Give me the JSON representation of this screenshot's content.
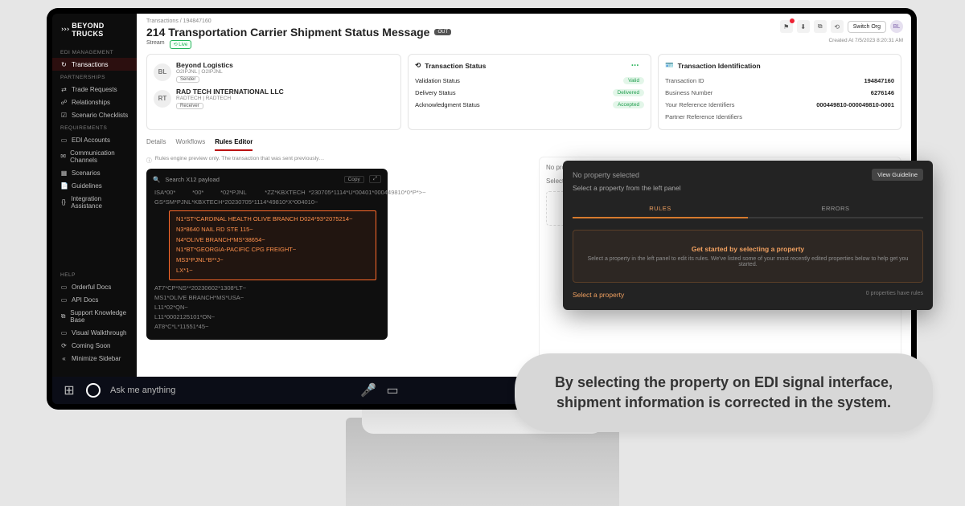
{
  "brand": {
    "name": "BEYOND TRUCKS"
  },
  "sidebar": {
    "section1_label": "EDI MANAGEMENT",
    "items1": [
      {
        "icon": "↻",
        "label": "Transactions",
        "active": true
      }
    ],
    "section2_label": "PARTNERSHIPS",
    "items2": [
      {
        "icon": "⇄",
        "label": "Trade Requests"
      },
      {
        "icon": "☍",
        "label": "Relationships"
      },
      {
        "icon": "☑",
        "label": "Scenario Checklists"
      }
    ],
    "section3_label": "REQUIREMENTS",
    "items3": [
      {
        "icon": "▭",
        "label": "EDI Accounts"
      },
      {
        "icon": "✉",
        "label": "Communication Channels"
      },
      {
        "icon": "▦",
        "label": "Scenarios"
      },
      {
        "icon": "📄",
        "label": "Guidelines"
      },
      {
        "icon": "{}",
        "label": "Integration Assistance"
      }
    ],
    "section4_label": "HELP",
    "items4": [
      {
        "icon": "▭",
        "label": "Orderful Docs"
      },
      {
        "icon": "▭",
        "label": "API Docs"
      },
      {
        "icon": "⧉",
        "label": "Support Knowledge Base"
      },
      {
        "icon": "▭",
        "label": "Visual Walkthrough"
      },
      {
        "icon": "⟳",
        "label": "Coming Soon"
      },
      {
        "icon": "«",
        "label": "Minimize Sidebar"
      }
    ]
  },
  "breadcrumb": "Transactions / 194847160",
  "title": "214 Transportation Carrier Shipment Status Message",
  "title_badge": "OUT",
  "stream_label": "Stream",
  "live_badge": "⟲ Live",
  "created_at_label": "Created At",
  "created_at_value": "7/5/2023 8:20:31 AM",
  "switch_org": "Switch Org",
  "parties": {
    "sender": {
      "initials": "BL",
      "name": "Beyond Logistics",
      "sub": "O2IPJNL | O2IPJNL",
      "chip": "Sender"
    },
    "receiver": {
      "initials": "RT",
      "name": "RAD TECH INTERNATIONAL LLC",
      "sub": "RADTECH | RADTECH",
      "chip": "Receiver"
    }
  },
  "tx_status": {
    "title": "Transaction Status",
    "rows": [
      {
        "label": "Validation Status",
        "badge": "Valid"
      },
      {
        "label": "Delivery Status",
        "badge": "Delivered"
      },
      {
        "label": "Acknowledgment Status",
        "badge": "Accepted"
      }
    ]
  },
  "tx_ident": {
    "title": "Transaction Identification",
    "rows": [
      {
        "k": "Transaction ID",
        "v": "194847160"
      },
      {
        "k": "Business Number",
        "v": "6276146"
      },
      {
        "k": "Your Reference Identifiers",
        "v": "000449810-000049810-0001"
      },
      {
        "k": "Partner Reference Identifiers",
        "v": ""
      }
    ]
  },
  "tabs": {
    "details": "Details",
    "workflows": "Workflows",
    "rules": "Rules Editor"
  },
  "rules_note": "Rules engine preview only. The transaction that was sent previously…",
  "code": {
    "search_placeholder": "Search X12 payload",
    "copy": "Copy",
    "line_isa": "ISA*00*          *00*          *02*PJNL           *ZZ*KBXTECH  *230705*1114*U*00401*000449810*0*P*>~",
    "line_gs": "GS*SM*PJNL*KBXTECH*20230705*1114*49810*X*004010~",
    "hl_lines": [
      "N1*ST*CARDINAL HEALTH OLIVE BRANCH D024*93*2075214~",
      "N3*8640 NAIL RD STE 115~",
      "N4*OLIVE BRANCH*MS*38654~",
      "N1*BT*GEORGIA-PACIFIC CPG FREIGHT~",
      "MS3*PJNL*B**J~",
      "LX*1~"
    ],
    "lines_after": [
      "AT7*CP*NS**20230602*1308*LT~",
      "MS1*OLIVE BRANCH*MS*USA~",
      "L11*02*QN~",
      "L11*0002125101*ON~",
      "AT8*C*L*11551*45~"
    ]
  },
  "ghost": {
    "no_prop": "No property selected",
    "select1": "Select a property from the panel",
    "select2": "Select a property"
  },
  "float_panel": {
    "no_prop": "No property selected",
    "view_guideline": "View Guideline",
    "sub": "Select a property from the left panel",
    "tab_rules": "RULES",
    "tab_errors": "ERRORS",
    "box_title": "Get started by selecting a property",
    "box_sub": "Select a property in the left panel to edit its rules. We've listed some of your most recently edited properties below to help get you started.",
    "link": "Select a property",
    "count": "0 properties have rules"
  },
  "taskbar": {
    "ask": "Ask me anything"
  },
  "caption": "By selecting the property on EDI signal interface, shipment information is corrected in the system."
}
